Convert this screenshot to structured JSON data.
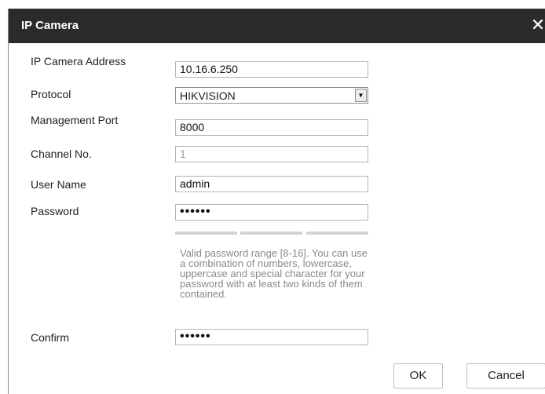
{
  "dialog": {
    "title": "IP Camera",
    "close_glyph": "✕"
  },
  "form": {
    "ip_label": "IP Camera Address",
    "ip_value": "10.16.6.250",
    "protocol_label": "Protocol",
    "protocol_value": "HIKVISION",
    "port_label": "Management Port",
    "port_value": "8000",
    "channel_label": "Channel No.",
    "channel_value": "1",
    "user_label": "User Name",
    "user_value": "admin",
    "password_label": "Password",
    "password_mask": "••••••",
    "password_hint": "Valid password range [8-16]. You can use a combination of numbers, lowercase, uppercase and special character for your password with at least two kinds of them contained.",
    "confirm_label": "Confirm",
    "confirm_mask": "••••••"
  },
  "buttons": {
    "ok": "OK",
    "cancel": "Cancel"
  },
  "colors": {
    "titlebar": "#2b2b2b",
    "hint": "#8a8a8a",
    "strength_bar": "#d4d4d4"
  },
  "icons": {
    "close": "close-icon",
    "dropdown": "chevron-down-icon"
  }
}
